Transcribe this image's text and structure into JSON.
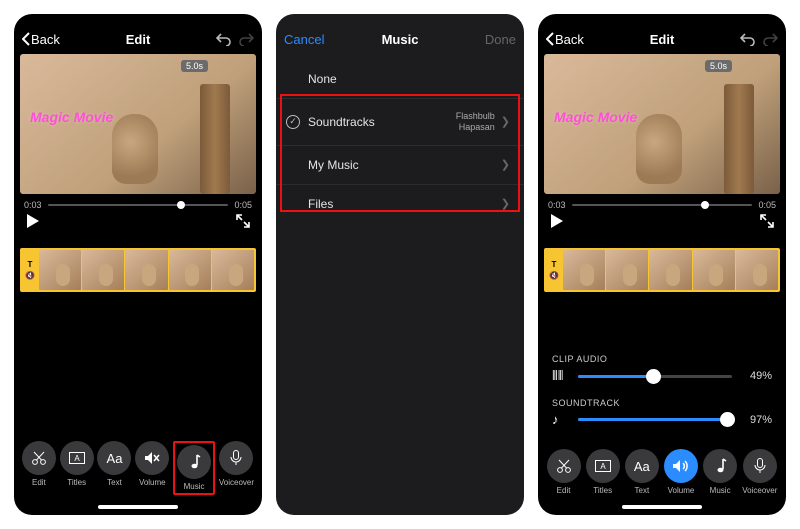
{
  "screens": {
    "edit1": {
      "back": "Back",
      "title": "Edit",
      "badge": "5.0s",
      "magic": "Magic Movie",
      "time_cur": "0:03",
      "time_end": "0:05",
      "tools": {
        "edit": "Edit",
        "titles": "Titles",
        "text": "Text",
        "volume": "Volume",
        "music": "Music",
        "voiceover": "Voiceover"
      }
    },
    "music": {
      "cancel": "Cancel",
      "title": "Music",
      "done": "Done",
      "rows": {
        "none": "None",
        "soundtracks": "Soundtracks",
        "soundtracks_sub1": "Flashbulb",
        "soundtracks_sub2": "Hapasan",
        "mymusic": "My Music",
        "files": "Files"
      }
    },
    "edit2": {
      "back": "Back",
      "title": "Edit",
      "badge": "5.0s",
      "magic": "Magic Movie",
      "time_cur": "0:03",
      "time_end": "0:05",
      "clip_audio_label": "CLIP AUDIO",
      "clip_audio_value": "49%",
      "soundtrack_label": "SOUNDTRACK",
      "soundtrack_value": "97%",
      "tools": {
        "edit": "Edit",
        "titles": "Titles",
        "text": "Text",
        "volume": "Volume",
        "music": "Music",
        "voiceover": "Voiceover"
      }
    }
  }
}
